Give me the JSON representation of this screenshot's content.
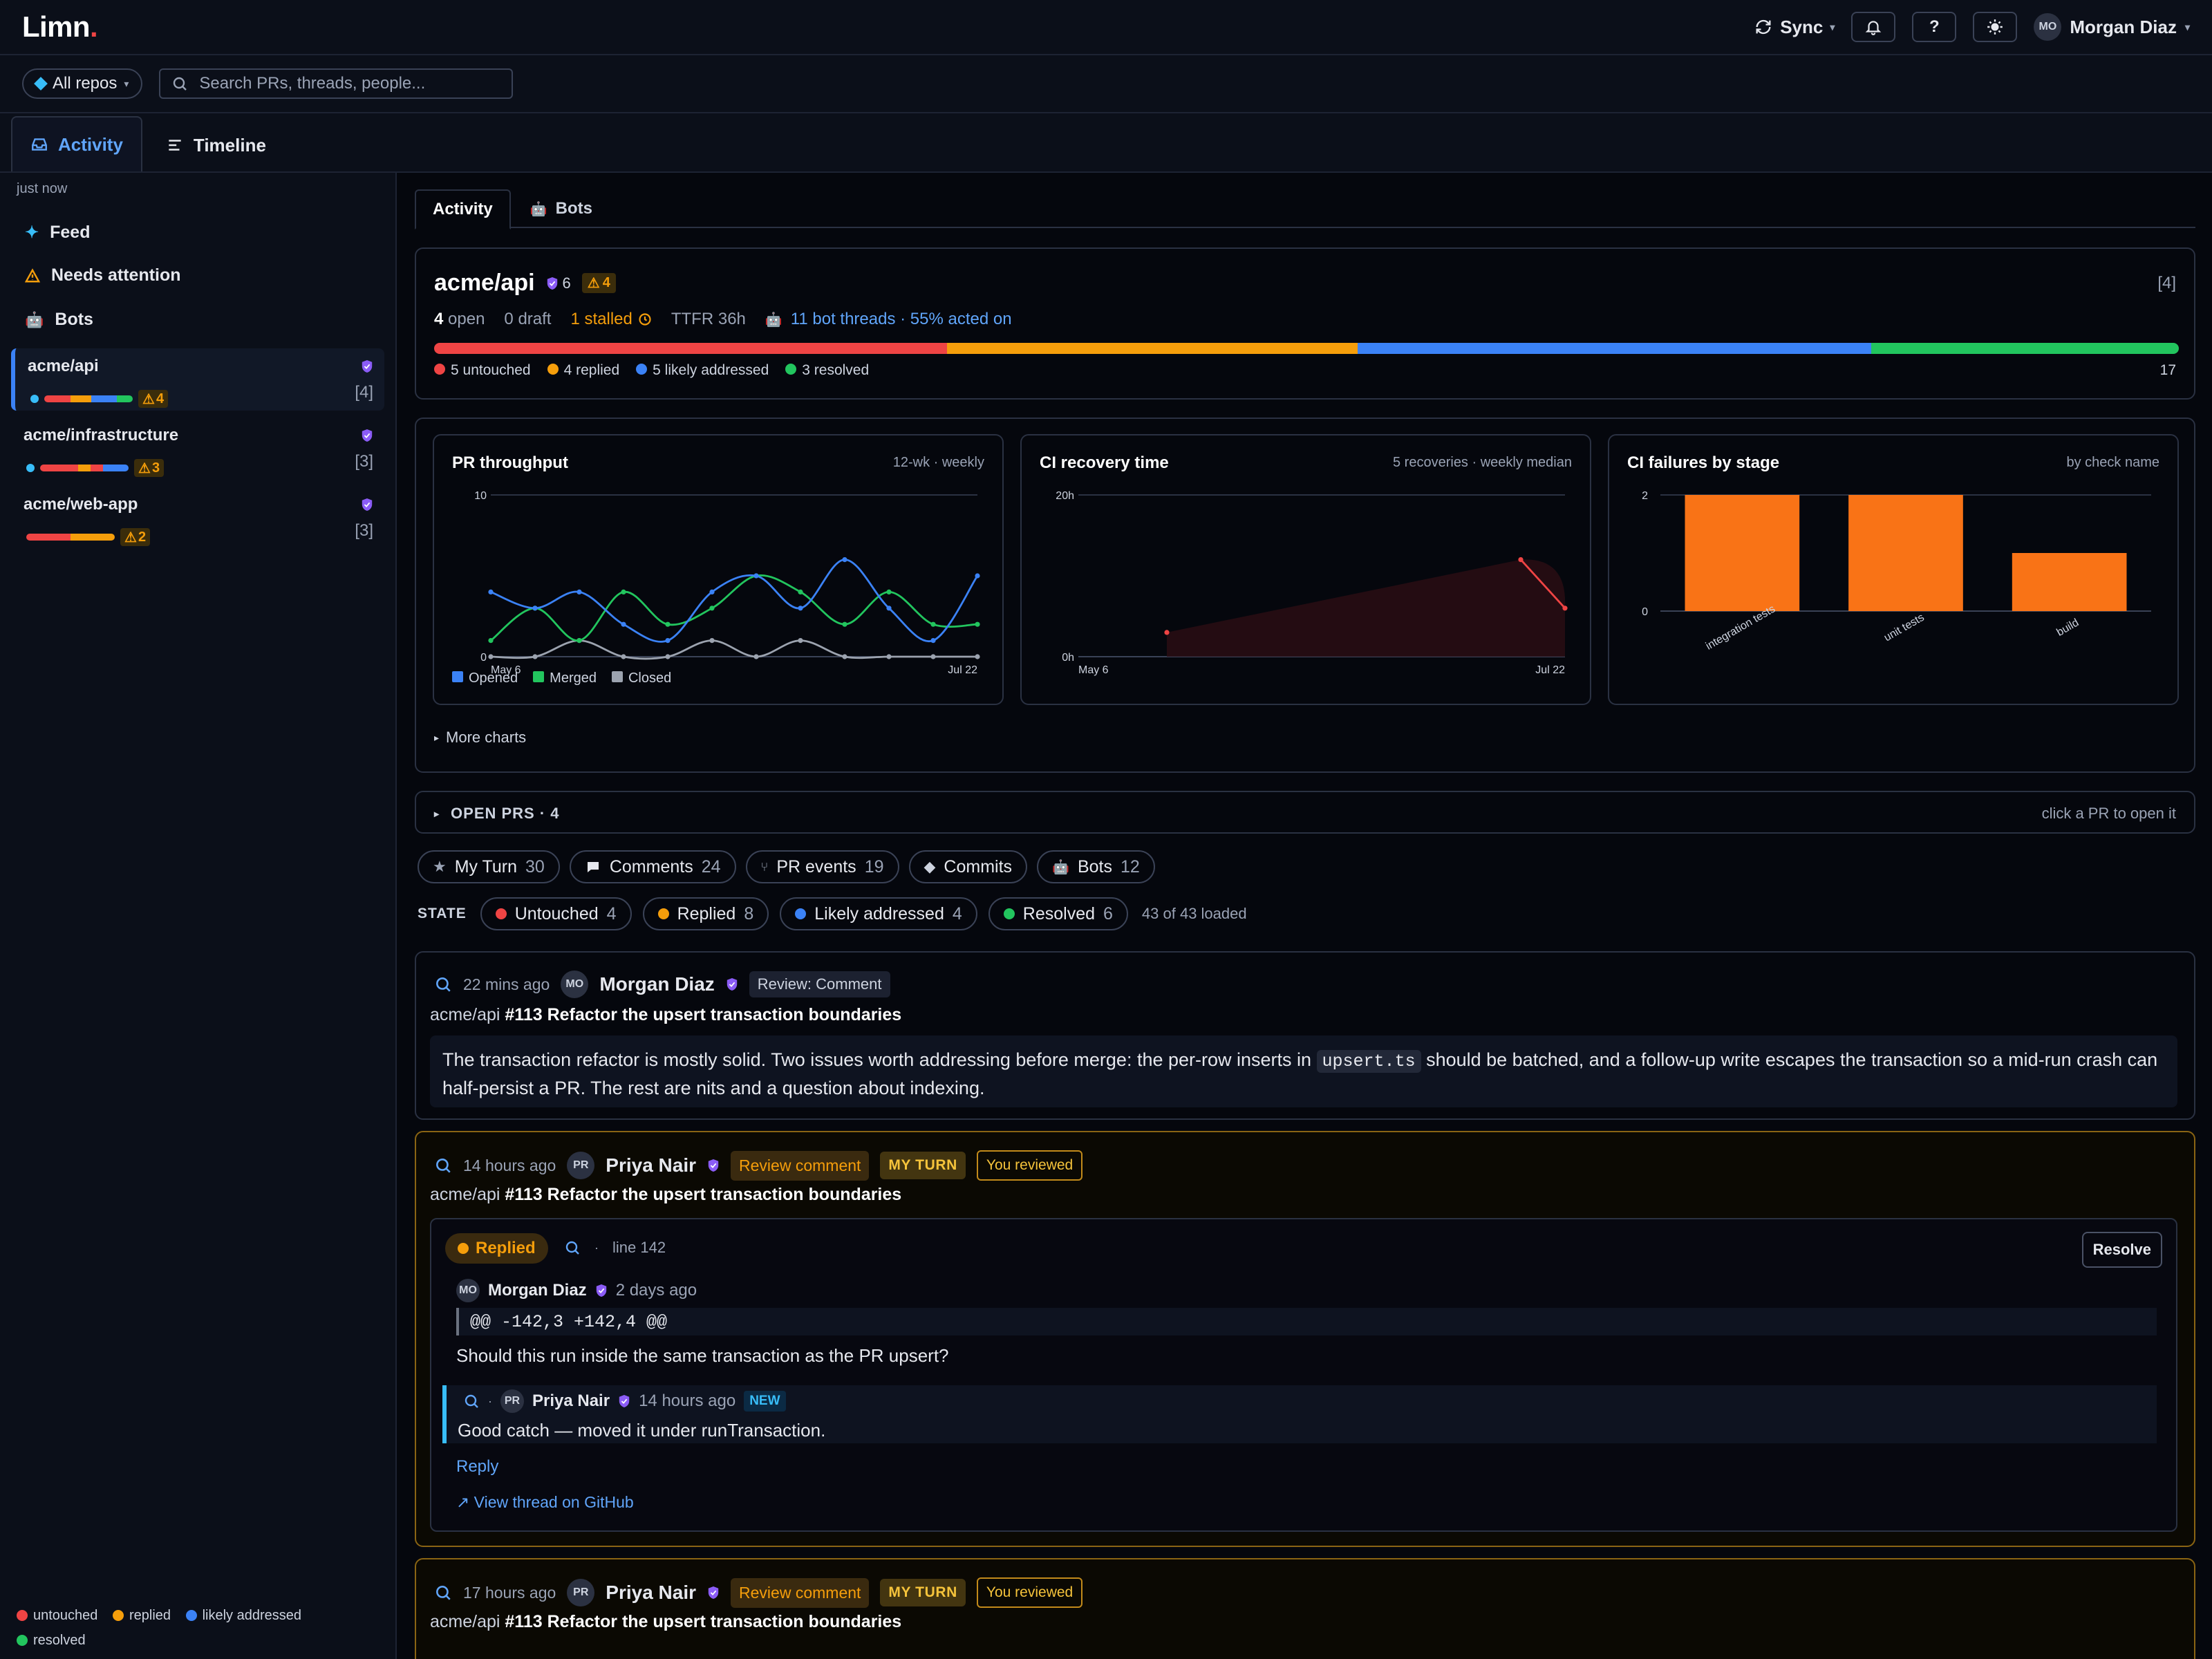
{
  "app": {
    "logo": "Limn",
    "logo_dot": "."
  },
  "topbar": {
    "sync_label": "Sync",
    "help_label": "?",
    "user_initials": "MO",
    "user_name": "Morgan Diaz"
  },
  "filterbar": {
    "repo_select": "All repos",
    "search_placeholder": "Search PRs, threads, people..."
  },
  "view_tabs": [
    {
      "label": "Activity",
      "active": true
    },
    {
      "label": "Timeline",
      "active": false
    }
  ],
  "sidebar": {
    "updated": "just now",
    "nav": [
      {
        "label": "Feed",
        "icon": "sparkle-icon"
      },
      {
        "label": "Needs attention",
        "icon": "warning-icon"
      },
      {
        "label": "Bots",
        "icon": "robot-icon"
      }
    ],
    "repos": [
      {
        "name": "acme/api",
        "count": "[4]",
        "warn": "4",
        "selected": true
      },
      {
        "name": "acme/infrastructure",
        "count": "[3]",
        "warn": "3",
        "selected": false
      },
      {
        "name": "acme/web-app",
        "count": "[3]",
        "warn": "2",
        "selected": false
      }
    ],
    "legend": [
      "untouched",
      "replied",
      "likely addressed",
      "resolved"
    ]
  },
  "colors": {
    "untouched": "#ef4444",
    "replied": "#f59e0b",
    "likely_addressed": "#3b82f6",
    "resolved": "#22c55e",
    "accent": "#60a5fa",
    "bar": "#f97316"
  },
  "subtabs": [
    {
      "label": "Activity",
      "active": true
    },
    {
      "label": "Bots",
      "active": false
    }
  ],
  "repo_card": {
    "name": "acme/api",
    "checks": "6",
    "warnings": "4",
    "bracket": "[4]",
    "open_count": "4",
    "open_label": "open",
    "draft": "0 draft",
    "stalled": "1 stalled",
    "ttfr": "TTFR 36h",
    "bot_threads": "11 bot threads · 55% acted on",
    "breakdown": [
      {
        "label": "untouched",
        "count": 5,
        "text": "5 untouched"
      },
      {
        "label": "replied",
        "count": 4,
        "text": "4 replied"
      },
      {
        "label": "likely addressed",
        "count": 5,
        "text": "5 likely addressed"
      },
      {
        "label": "resolved",
        "count": 3,
        "text": "3 resolved"
      }
    ],
    "total": "17"
  },
  "charts": {
    "throughput": {
      "title": "PR throughput",
      "subtitle": "12-wk · weekly"
    },
    "recovery": {
      "title": "CI recovery time",
      "subtitle": "5 recoveries · weekly median"
    },
    "failures": {
      "title": "CI failures by stage",
      "subtitle": "by check name"
    },
    "more_label": "More charts"
  },
  "chart_data": [
    {
      "type": "line",
      "title": "PR throughput",
      "x": [
        "May 6",
        "May 13",
        "May 20",
        "May 27",
        "Jun 3",
        "Jun 10",
        "Jun 17",
        "Jun 24",
        "Jul 1",
        "Jul 8",
        "Jul 15",
        "Jul 22"
      ],
      "x_tick_labels": [
        "May 6",
        "Jul 22"
      ],
      "ylim": [
        0,
        10
      ],
      "y_ticks": [
        "0",
        "10"
      ],
      "series": [
        {
          "name": "Opened",
          "color": "#3b82f6",
          "values": [
            4,
            3,
            4,
            2,
            1,
            4,
            5,
            3,
            6,
            3,
            1,
            5
          ]
        },
        {
          "name": "Merged",
          "color": "#22c55e",
          "values": [
            1,
            3,
            1,
            4,
            2,
            3,
            5,
            4,
            2,
            4,
            2,
            2
          ]
        },
        {
          "name": "Closed",
          "color": "#9ca3af",
          "values": [
            0,
            0,
            1,
            0,
            0,
            1,
            0,
            1,
            0,
            0,
            0,
            0
          ]
        }
      ],
      "legend": [
        "Opened",
        "Merged",
        "Closed"
      ]
    },
    {
      "type": "line",
      "title": "CI recovery time",
      "x": [
        "May 6",
        "May 13",
        "May 20",
        "May 27",
        "Jun 3",
        "Jun 10",
        "Jun 17",
        "Jun 24",
        "Jul 1",
        "Jul 8",
        "Jul 15",
        "Jul 22"
      ],
      "x_tick_labels": [
        "May 6",
        "Jul 22"
      ],
      "ylim": [
        0,
        20
      ],
      "y_ticks": [
        "0h",
        "20h"
      ],
      "unit": "h",
      "series": [
        {
          "name": "",
          "color": "#ef4444",
          "values": [
            null,
            null,
            3,
            null,
            null,
            null,
            null,
            null,
            null,
            null,
            12,
            6
          ]
        }
      ]
    },
    {
      "type": "bar",
      "title": "CI failures by stage",
      "categories": [
        "integration tests",
        "unit tests",
        "build"
      ],
      "values": [
        2,
        2,
        1
      ],
      "ylim": [
        0,
        2
      ],
      "y_ticks": [
        "0",
        "2"
      ],
      "color": "#f97316"
    }
  ],
  "open_prs": {
    "label": "OPEN PRS · 4",
    "hint": "click a PR to open it"
  },
  "filter_chips": [
    {
      "label": "My Turn",
      "count": "30",
      "icon": "star-icon"
    },
    {
      "label": "Comments",
      "count": "24",
      "icon": "comment-icon"
    },
    {
      "label": "PR events",
      "count": "19",
      "icon": "pr-event-icon"
    },
    {
      "label": "Commits",
      "count": "",
      "icon": "commit-icon"
    },
    {
      "label": "Bots",
      "count": "12",
      "icon": "robot-icon"
    }
  ],
  "state_filter": {
    "label": "STATE",
    "chips": [
      {
        "label": "Untouched",
        "count": "4",
        "color": "#ef4444"
      },
      {
        "label": "Replied",
        "count": "8",
        "color": "#f59e0b"
      },
      {
        "label": "Likely addressed",
        "count": "4",
        "color": "#3b82f6"
      },
      {
        "label": "Resolved",
        "count": "6",
        "color": "#22c55e"
      }
    ],
    "loaded": "43 of 43 loaded"
  },
  "feed": [
    {
      "time": "22 mins ago",
      "initials": "MO",
      "author": "Morgan Diaz",
      "tag": "Review: Comment",
      "repo": "acme/api",
      "pr": "#113 Refactor the upsert transaction boundaries",
      "body_before": "The transaction refactor is mostly solid. Two issues worth addressing before merge: the per-row inserts in ",
      "body_code": "upsert.ts",
      "body_after": " should be batched, and a follow-up write escapes the transaction so a mid-run crash can half-persist a PR. The rest are nits and a question about indexing."
    },
    {
      "time": "14 hours ago",
      "initials": "PR",
      "author": "Priya Nair",
      "tag": "Review comment",
      "my_turn": "MY TURN",
      "reviewed": "You reviewed",
      "repo": "acme/api",
      "pr": "#113 Refactor the upsert transaction boundaries",
      "thread": {
        "state": "Replied",
        "line": "line 142",
        "resolve": "Resolve",
        "comment": {
          "initials": "MO",
          "author": "Morgan Diaz",
          "time": "2 days ago",
          "diff": "@@ -142,3 +142,4 @@",
          "body": "Should this run inside the same transaction as the PR upsert?"
        },
        "reply": {
          "initials": "PR",
          "author": "Priya Nair",
          "time": "14 hours ago",
          "new": "NEW",
          "body": "Good catch — moved it under runTransaction."
        },
        "reply_link": "Reply",
        "github_link": "View thread on GitHub"
      }
    },
    {
      "time": "17 hours ago",
      "initials": "PR",
      "author": "Priya Nair",
      "tag": "Review comment",
      "my_turn": "MY TURN",
      "reviewed": "You reviewed",
      "repo": "acme/api",
      "pr": "#113 Refactor the upsert transaction boundaries"
    }
  ]
}
